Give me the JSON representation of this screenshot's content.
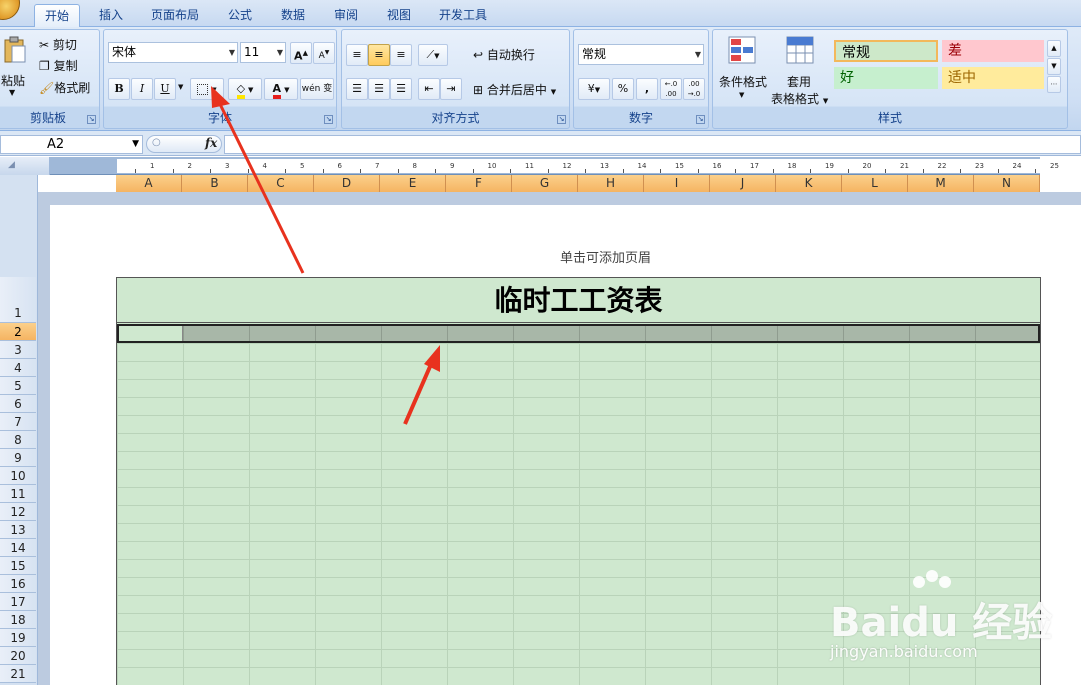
{
  "tabs": [
    "开始",
    "插入",
    "页面布局",
    "公式",
    "数据",
    "审阅",
    "视图",
    "开发工具"
  ],
  "clipboard": {
    "paste": "粘贴",
    "cut": "剪切",
    "copy": "复制",
    "painter": "格式刷",
    "label": "剪贴板"
  },
  "font": {
    "name": "宋体",
    "size": "11",
    "grow": "A",
    "shrink": "A",
    "bold": "B",
    "italic": "I",
    "underline": "U",
    "font_color": "A",
    "phonetic": "wén 变",
    "label": "字体"
  },
  "alignment": {
    "wrap": "自动换行",
    "merge": "合并后居中",
    "label": "对齐方式"
  },
  "number": {
    "format": "常规",
    "percent": "%",
    "comma": ",",
    "inc": "←.0 .00",
    "dec": ".00 →.0",
    "label": "数字"
  },
  "styles": {
    "conditional": "条件格式",
    "table_style_1": "套用",
    "table_style_2": "表格格式",
    "normal": "常规",
    "bad": "差",
    "good": "好",
    "neutral": "适中",
    "label": "样式"
  },
  "formula_bar": {
    "name_box": "A2",
    "fx": "fx"
  },
  "ruler": [
    "1",
    "2",
    "3",
    "4",
    "5",
    "6",
    "7",
    "8",
    "9",
    "10",
    "11",
    "12",
    "13",
    "14",
    "15",
    "16",
    "17",
    "18",
    "19",
    "20",
    "21",
    "22",
    "23",
    "24",
    "25"
  ],
  "columns": [
    "A",
    "B",
    "C",
    "D",
    "E",
    "F",
    "G",
    "H",
    "I",
    "J",
    "K",
    "L",
    "M",
    "N"
  ],
  "rows": [
    "1",
    "2",
    "3",
    "4",
    "5",
    "6",
    "7",
    "8",
    "9",
    "10",
    "11",
    "12",
    "13",
    "14",
    "15",
    "16",
    "17",
    "18",
    "19",
    "20",
    "21"
  ],
  "page": {
    "header_hint": "单击可添加页眉",
    "title": "临时工工资表"
  },
  "watermark": {
    "logo": "Baidu 经验",
    "url": "jingyan.baidu.com"
  },
  "colors": {
    "sheet_fill": "#cfe8cf",
    "arrow": "#e8321e",
    "col_header": "#f5b462"
  }
}
